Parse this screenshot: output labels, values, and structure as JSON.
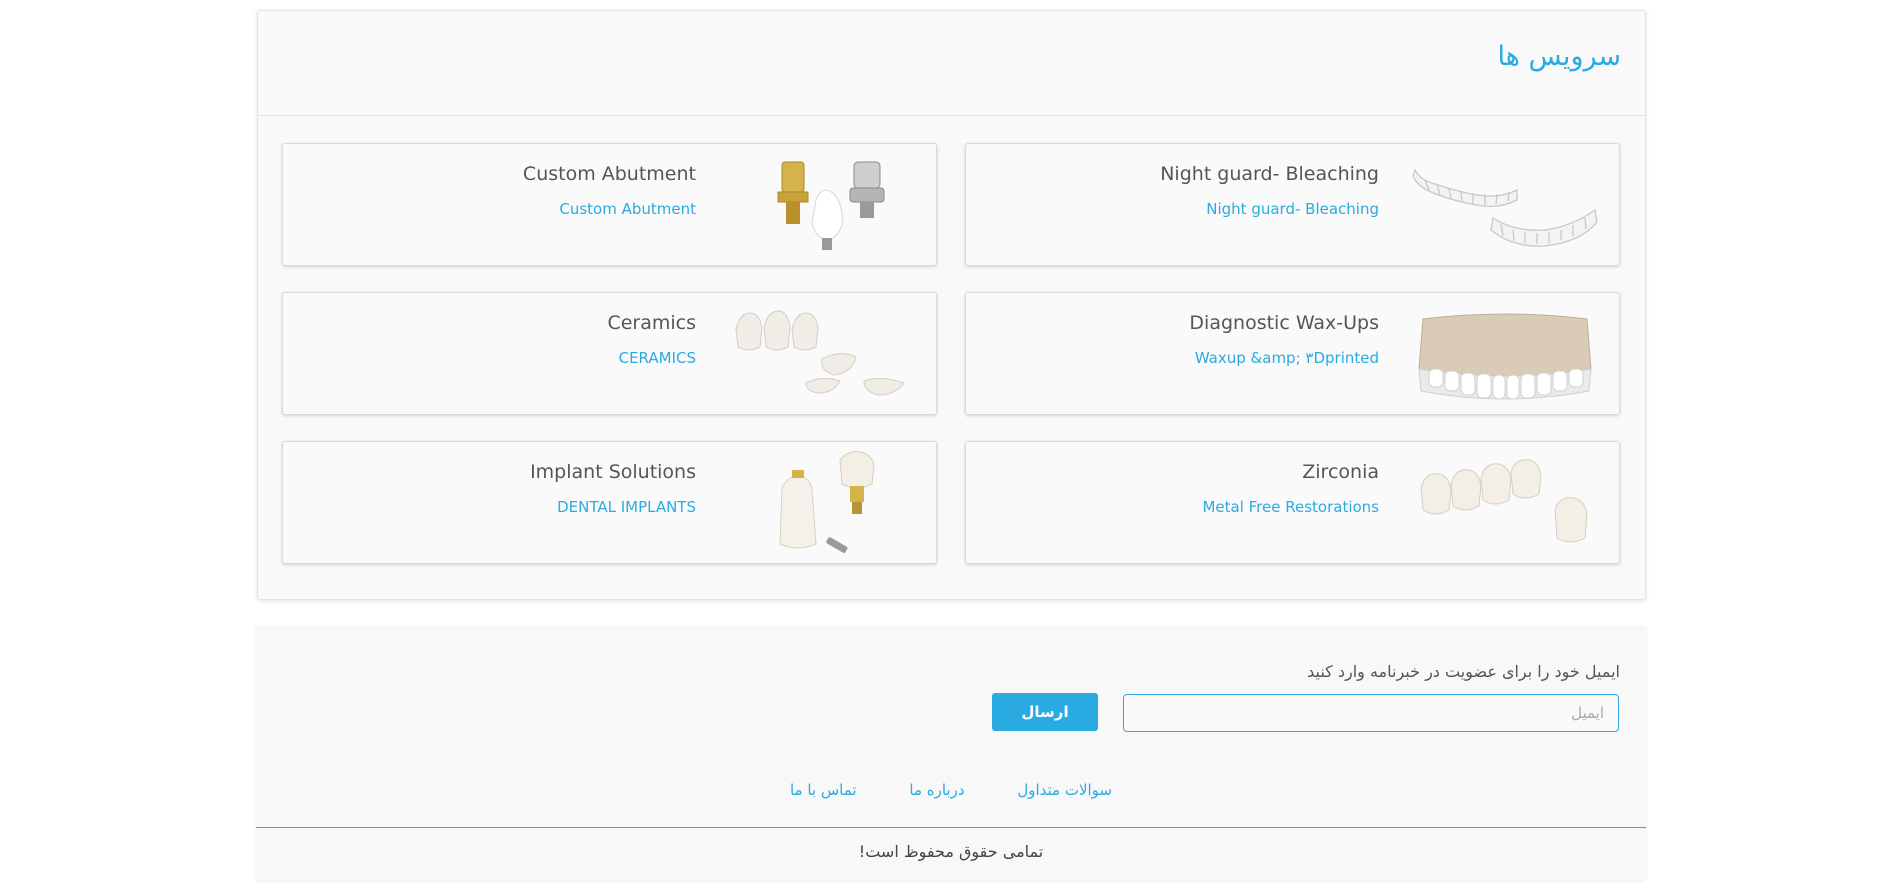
{
  "services": {
    "title": "سرویس ها",
    "cards": [
      {
        "title": "Night guard- Bleaching",
        "subtitle": "Night guard- Bleaching",
        "image": "clear-aligner-trays"
      },
      {
        "title": "Custom Abutment",
        "subtitle": "Custom Abutment",
        "image": "implant-abutments"
      },
      {
        "title": "Diagnostic Wax-Ups",
        "subtitle": "Waxup &amp; ۳Dprinted",
        "image": "dental-wax-model"
      },
      {
        "title": "Ceramics",
        "subtitle": "CERAMICS",
        "image": "ceramic-crowns-veneers"
      },
      {
        "title": "Zirconia",
        "subtitle": "Metal Free Restorations",
        "image": "zirconia-bridge"
      },
      {
        "title": "Implant Solutions",
        "subtitle": "DENTAL IMPLANTS",
        "image": "implant-crown"
      }
    ]
  },
  "newsletter": {
    "label": "ایمیل خود را برای عضویت در خبرنامه وارد کنید",
    "email_placeholder": "ایمیل",
    "send_label": "ارسال"
  },
  "footer": {
    "links": [
      {
        "label": "سوالات متداول"
      },
      {
        "label": "درباره ما"
      },
      {
        "label": "تماس با ما"
      }
    ],
    "copyright": "تمامی حقوق محفوظ است!"
  },
  "colors": {
    "accent": "#29abe2",
    "panel_bg": "#f9f9f9",
    "text": "#555555"
  }
}
